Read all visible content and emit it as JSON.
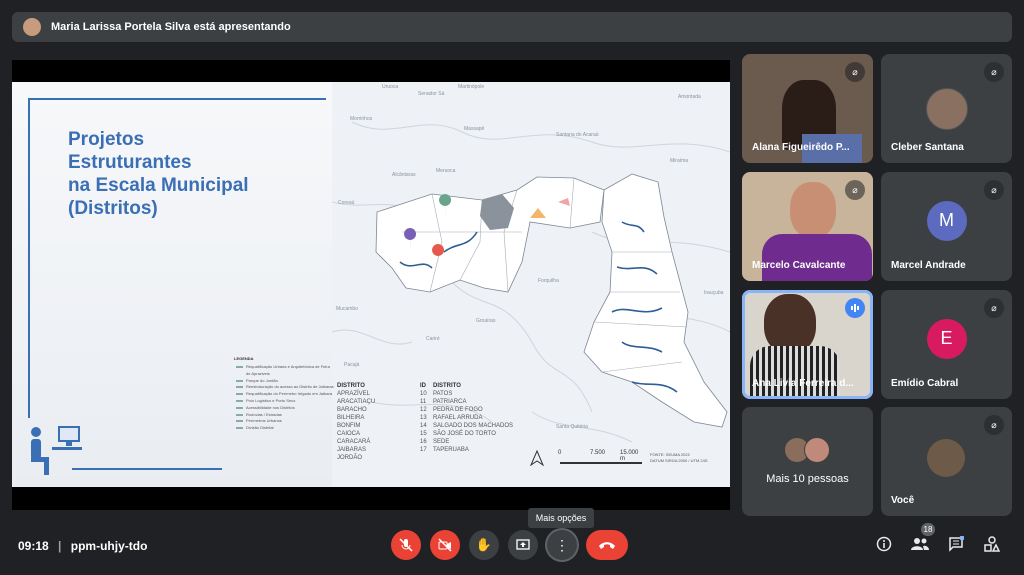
{
  "banner": {
    "presenting": "Maria Larissa Portela Silva está apresentando"
  },
  "slide": {
    "title_lines": [
      "Projetos",
      "Estruturantes",
      "na Escala Municipal",
      "(Distritos)"
    ],
    "legend_title": "LEGENDA",
    "legend_items": [
      "Requalificação Urbana e Arquitetônica de Feira de Apraziveis",
      "Parque do Jordão",
      "Reestruturação do acesso ao Distrito de Jaibaras",
      "Requalificação do Perímetro Irrigado em Jaibara",
      "Polo Logístico e Porto Seco",
      "Acessibilidade nos Distritos",
      "Rodovias / Estradas",
      "Perímetros Urbanos",
      "Divisão Distrital"
    ],
    "district_header": "DISTRITO",
    "id_header": "ID",
    "districts_left": [
      "APRAZÍVEL",
      "ARACATIAÇU",
      "BARACHO",
      "BILHEIRA",
      "BONFIM",
      "CAIOCA",
      "CARACARÁ",
      "JAIBARAS",
      "JORDÃO"
    ],
    "districts_right": [
      {
        "id": "10",
        "name": "PATOS"
      },
      {
        "id": "11",
        "name": "PATRIARCA"
      },
      {
        "id": "12",
        "name": "PEDRA DE FOGO"
      },
      {
        "id": "13",
        "name": "RAFAEL ARRUDA"
      },
      {
        "id": "14",
        "name": "SALGADO DOS MACHADOS"
      },
      {
        "id": "15",
        "name": "SÃO JOSÉ DO TORTO"
      },
      {
        "id": "16",
        "name": "SEDE"
      },
      {
        "id": "17",
        "name": "TAPERUABA"
      }
    ],
    "scale": {
      "zero": "0",
      "mid": "7.500",
      "end": "15.000 m"
    },
    "source_lines": [
      "FONTE: SEUMA 2022",
      "DATUM SIRGA 2000 / UTM 24S"
    ],
    "map_places": [
      "Uruoca",
      "Senador Sá",
      "Martinópole",
      "Morrinhos",
      "Massapê",
      "Santana do Acaraú",
      "Amontada",
      "Meruoca",
      "Alcântaras",
      "Coreaú",
      "Miraíma",
      "Mucambo",
      "Forquilha",
      "Groaíras",
      "Irauçuba",
      "Cariré",
      "Pacujá",
      "Santa Quitéria"
    ]
  },
  "participants": [
    {
      "name": "Alana Figueirêdo P...",
      "muted": true,
      "kind": "video"
    },
    {
      "name": "Cleber Santana",
      "muted": true,
      "kind": "photo"
    },
    {
      "name": "Marcelo Cavalcante",
      "muted": true,
      "kind": "video"
    },
    {
      "name": "Marcel Andrade",
      "muted": true,
      "kind": "letter",
      "letter": "M",
      "color": "#5c6bc0"
    },
    {
      "name": "Ana Livia Ferreira d...",
      "muted": false,
      "kind": "video",
      "speaking": true
    },
    {
      "name": "Emídio Cabral",
      "muted": true,
      "kind": "letter",
      "letter": "E",
      "color": "#d81b60"
    },
    {
      "name": "Mais 10 pessoas",
      "kind": "more"
    },
    {
      "name": "Você",
      "muted": true,
      "kind": "photo"
    }
  ],
  "bottom": {
    "time": "09:18",
    "separator": "|",
    "meeting_code": "ppm-uhjy-tdo",
    "tooltip": "Mais opções",
    "people_count": "18"
  },
  "icons": {
    "mic_off": "mic-off-icon",
    "cam_off": "videocam-off-icon",
    "raise_hand": "hand-icon",
    "present": "present-icon",
    "more": "more-vert-icon",
    "hangup": "call-end-icon",
    "info": "info-icon",
    "people": "people-icon",
    "chat": "chat-icon",
    "activities": "activities-icon"
  },
  "colors": {
    "red": "#ea4335",
    "speaking_border": "#8ab4f8",
    "bg": "#202124",
    "tile": "#3c4043"
  }
}
